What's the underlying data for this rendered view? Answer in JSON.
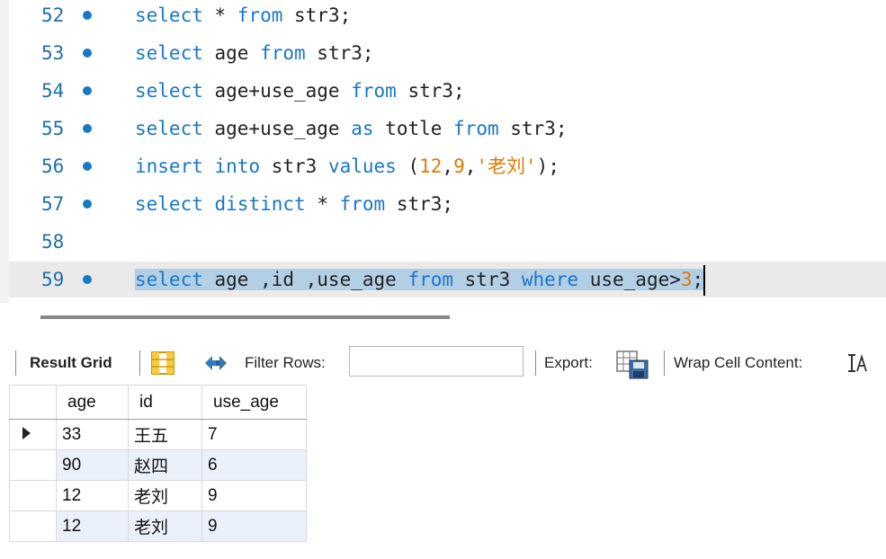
{
  "editor": {
    "lines": [
      {
        "num": "52",
        "has_dot": true,
        "tokens": [
          {
            "t": "select",
            "c": "kw"
          },
          {
            "t": " * ",
            "c": ""
          },
          {
            "t": "from",
            "c": "kw"
          },
          {
            "t": " str3;",
            "c": ""
          }
        ]
      },
      {
        "num": "53",
        "has_dot": true,
        "tokens": [
          {
            "t": "select",
            "c": "kw"
          },
          {
            "t": " age ",
            "c": ""
          },
          {
            "t": "from",
            "c": "kw"
          },
          {
            "t": " str3;",
            "c": ""
          }
        ]
      },
      {
        "num": "54",
        "has_dot": true,
        "tokens": [
          {
            "t": "select",
            "c": "kw"
          },
          {
            "t": " age+use_age ",
            "c": ""
          },
          {
            "t": "from",
            "c": "kw"
          },
          {
            "t": " str3;",
            "c": ""
          }
        ]
      },
      {
        "num": "55",
        "has_dot": true,
        "tokens": [
          {
            "t": "select",
            "c": "kw"
          },
          {
            "t": " age+use_age ",
            "c": ""
          },
          {
            "t": "as",
            "c": "kw"
          },
          {
            "t": " totle ",
            "c": ""
          },
          {
            "t": "from",
            "c": "kw"
          },
          {
            "t": " str3;",
            "c": ""
          }
        ]
      },
      {
        "num": "56",
        "has_dot": true,
        "tokens": [
          {
            "t": "insert",
            "c": "kw"
          },
          {
            "t": " ",
            "c": ""
          },
          {
            "t": "into",
            "c": "kw"
          },
          {
            "t": " str3 ",
            "c": ""
          },
          {
            "t": "values",
            "c": "kw"
          },
          {
            "t": " (",
            "c": ""
          },
          {
            "t": "12",
            "c": "num"
          },
          {
            "t": ",",
            "c": ""
          },
          {
            "t": "9",
            "c": "num"
          },
          {
            "t": ",",
            "c": ""
          },
          {
            "t": "'老刘'",
            "c": "str"
          },
          {
            "t": ");",
            "c": ""
          }
        ]
      },
      {
        "num": "57",
        "has_dot": true,
        "tokens": [
          {
            "t": "select",
            "c": "kw"
          },
          {
            "t": " ",
            "c": ""
          },
          {
            "t": "distinct",
            "c": "kw"
          },
          {
            "t": " * ",
            "c": ""
          },
          {
            "t": "from",
            "c": "kw"
          },
          {
            "t": " str3;",
            "c": ""
          }
        ]
      },
      {
        "num": "58",
        "has_dot": false,
        "tokens": []
      },
      {
        "num": "59",
        "has_dot": true,
        "current": true,
        "selected": true,
        "tokens": [
          {
            "t": "select",
            "c": "kw"
          },
          {
            "t": " age ,id ,use_age ",
            "c": ""
          },
          {
            "t": "from",
            "c": "kw"
          },
          {
            "t": " str3 ",
            "c": ""
          },
          {
            "t": "where",
            "c": "kw"
          },
          {
            "t": " use_age>",
            "c": ""
          },
          {
            "t": "3",
            "c": "num"
          },
          {
            "t": ";",
            "c": ""
          }
        ]
      }
    ]
  },
  "toolbar": {
    "result_grid_label": "Result Grid",
    "filter_label": "Filter Rows:",
    "filter_value": "",
    "export_label": "Export:",
    "wrap_label": "Wrap Cell Content:"
  },
  "grid": {
    "columns": [
      "age",
      "id",
      "use_age"
    ],
    "rows": [
      [
        "33",
        "王五",
        "7"
      ],
      [
        "90",
        "赵四",
        "6"
      ],
      [
        "12",
        "老刘",
        "9"
      ],
      [
        "12",
        "老刘",
        "9"
      ]
    ],
    "current_row": 0
  },
  "colors": {
    "keyword": "#1a77c8",
    "number": "#e07a00",
    "selection": "#b3cfe6",
    "alt_row": "#eaf1fa"
  }
}
